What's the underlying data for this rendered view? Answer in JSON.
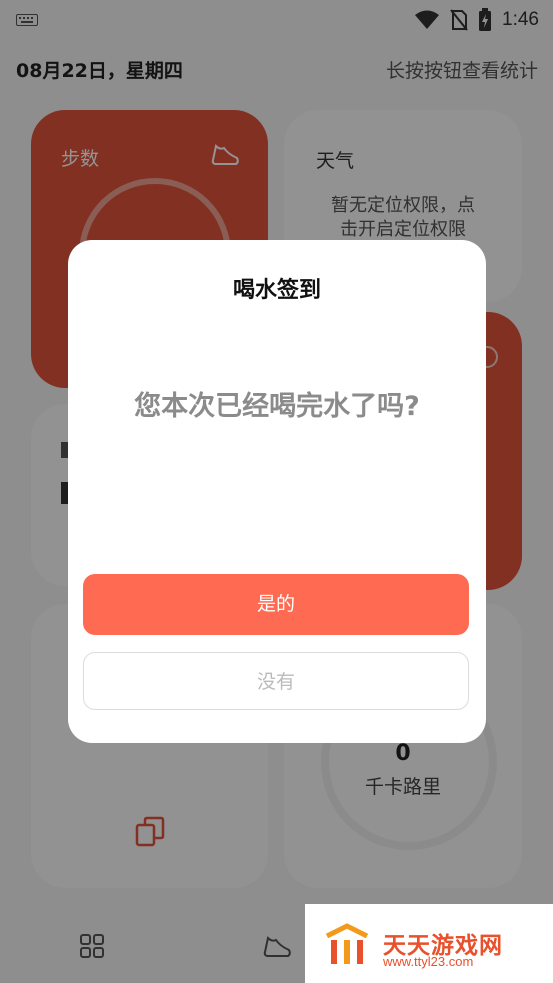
{
  "status_bar": {
    "time": "1:46",
    "icons": [
      "keyboard-icon",
      "wifi-icon",
      "no-sim-icon",
      "battery-charging-icon"
    ]
  },
  "header": {
    "date": "08月22日，星期四",
    "hint": "长按按钮查看统计"
  },
  "cards": {
    "steps": {
      "title": "步数",
      "icon": "shoe-icon"
    },
    "weather": {
      "title": "天气",
      "message_line1": "暂无定位权限，点",
      "message_line2": "击开启定位权限"
    },
    "calories": {
      "value": "0",
      "label": "千卡路里"
    }
  },
  "bottom_nav": {
    "items": [
      {
        "icon": "grid-icon"
      },
      {
        "icon": "shoe-icon"
      }
    ]
  },
  "dialog": {
    "title": "喝水签到",
    "question": "您本次已经喝完水了吗?",
    "yes_label": "是的",
    "no_label": "没有"
  },
  "watermark": {
    "brand": "天天游戏网",
    "url": "www.ttyl23.com"
  },
  "colors": {
    "accent": "#ff6b52",
    "card_red": "#e0533b",
    "overlay": "rgba(0,0,0,0.42)"
  }
}
